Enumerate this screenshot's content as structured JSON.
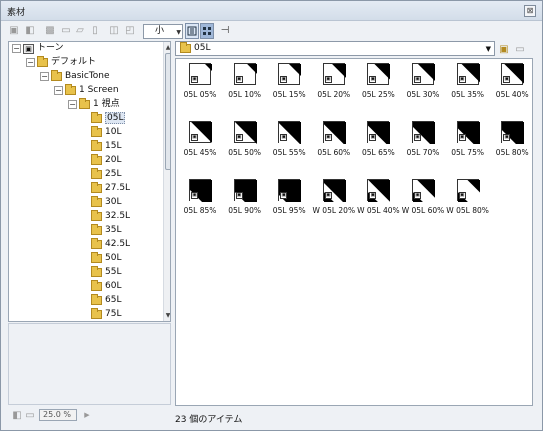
{
  "window": {
    "title": "素材"
  },
  "toolbar": {
    "zoom_value": "小",
    "icons": [
      "new-folder-icon",
      "new-material-icon",
      "pattern-icon",
      "open-folder-icon",
      "import-icon",
      "trash-icon",
      "properties-icon",
      "copy-icon"
    ]
  },
  "tree": {
    "root": "トーン",
    "default": "デフォルト",
    "basictone": "BasicTone",
    "screen": "1 Screen",
    "viewpoint": "1 視点",
    "items": [
      "05L",
      "10L",
      "15L",
      "20L",
      "25L",
      "27.5L",
      "30L",
      "32.5L",
      "35L",
      "42.5L",
      "50L",
      "55L",
      "60L",
      "65L",
      "75L"
    ],
    "selected": "05L"
  },
  "path": {
    "label": "05L"
  },
  "items": [
    "05L 05%",
    "05L 10%",
    "05L 15%",
    "05L 20%",
    "05L 25%",
    "05L 30%",
    "05L 35%",
    "05L 40%",
    "05L 45%",
    "05L 50%",
    "05L 55%",
    "05L 60%",
    "05L 65%",
    "05L 70%",
    "05L 75%",
    "05L 80%",
    "05L 85%",
    "05L 90%",
    "05L 95%",
    "W 05L 20%",
    "W 05L 40%",
    "W 05L 60%",
    "W 05L 80%"
  ],
  "item_levels": [
    0.05,
    0.1,
    0.15,
    0.2,
    0.25,
    0.3,
    0.35,
    0.4,
    0.45,
    0.5,
    0.55,
    0.6,
    0.65,
    0.7,
    0.75,
    0.8,
    0.85,
    0.9,
    0.95,
    0.2,
    0.4,
    0.6,
    0.8
  ],
  "status": {
    "count_text": "23 個のアイテム",
    "zoom_percent": "25.0 %"
  },
  "colors": {
    "folder": "#e8c24b",
    "selected": "#dde6f2"
  }
}
